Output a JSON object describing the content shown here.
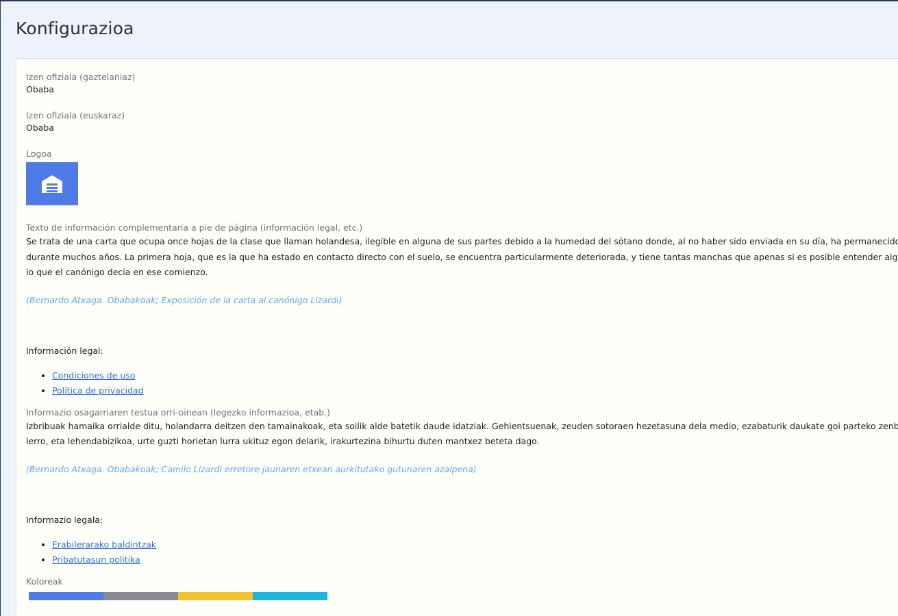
{
  "page": {
    "title": "Konfigurazioa"
  },
  "fields": {
    "name_es": {
      "label": "Izen ofiziala (gaztelaniaz)",
      "value": "Obaba"
    },
    "name_eu": {
      "label": "Izen ofiziala (euskaraz)",
      "value": "Obaba"
    },
    "logo": {
      "label": "Logoa",
      "icon": "building-garage-icon",
      "color": "#4f7be8"
    }
  },
  "footer_es": {
    "label": "Texto de información complementaria a pie de página (información legal, etc.)",
    "text": "Se trata de una carta que ocupa once hojas de la clase que llaman holandesa, ilegible en alguna de sus partes debido a la humedad del sótano donde, al no haber sido enviada en su día, ha permanecido durante muchos años. La primera hoja, que es la que ha estado en contacto directo con el suelo, se encuentra particularmente deteriorada, y tiene tantas manchas que apenas si es posible entender algo de lo que el canónigo decía en ese comienzo.",
    "quote": "(Bernardo Atxaga. Obabakoak; Exposición de la carta al canónigo Lizardi)",
    "legal_title": "Información legal:",
    "links": [
      "Condiciones de uso",
      "Política de privacidad"
    ]
  },
  "footer_eu": {
    "label": "Informazio osagarriaren testua orri-oinean (legezko informazioa, etab.)",
    "text": "Izbribuak hamaika orrialde ditu, holandarra deitzen den tamainakoak, eta soilik alde batetik daude idatziak. Gehientsuenak, zeuden sotoraen hezetasuna dela medio, ezabaturik daukate goi parteko zenbait lerro, eta lehendabizikoa, urte guzti horietan lurra ukituz egon delarik, irakurtezina bihurtu duten mantxez beteta dago.",
    "quote": "(Bernardo Atxaga. Obabakoak; Camilo Lizardi erretore jaunaren etxean aurkitutako gutunaren azalpena)",
    "legal_title": "Informazio legala:",
    "links": [
      "Erabilerarako baldintzak",
      "Pribatutasun politika"
    ]
  },
  "colors": {
    "label": "Koloreak",
    "swatches": [
      "#4f7be8",
      "#8a8a94",
      "#f2c230",
      "#1fb5de"
    ]
  }
}
